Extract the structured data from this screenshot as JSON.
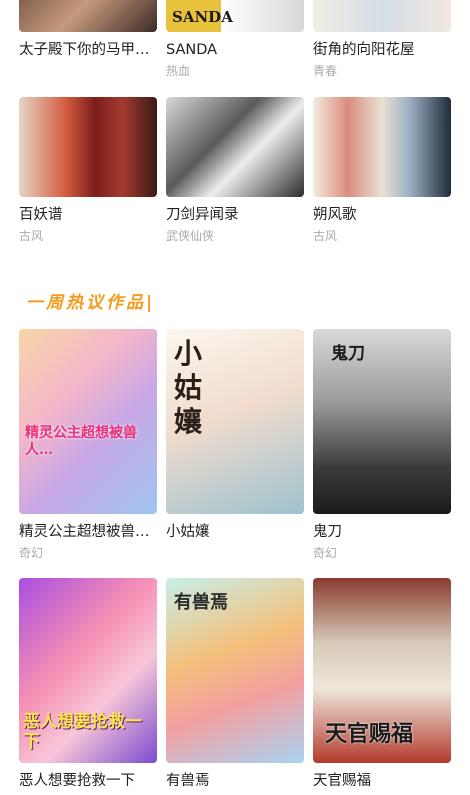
{
  "row1": [
    {
      "title": "太子殿下你的马甲…",
      "tag": ""
    },
    {
      "title": "SANDA",
      "tag": "热血",
      "cover_text": "SANDA"
    },
    {
      "title": "街角的向阳花屋",
      "tag": "青春"
    }
  ],
  "row2": [
    {
      "title": "百妖谱",
      "tag": "古风"
    },
    {
      "title": "刀剑异闻录",
      "tag": "武侠仙侠"
    },
    {
      "title": "朔风歌",
      "tag": "古风"
    }
  ],
  "section": {
    "title": "一周热议作品|"
  },
  "row3": [
    {
      "title": "精灵公主超想被兽…",
      "tag": "奇幻",
      "cover_text": "精灵公主超想被兽人…"
    },
    {
      "title": "小姑孃",
      "tag": "",
      "cover_text": "小姑孃"
    },
    {
      "title": "鬼刀",
      "tag": "奇幻",
      "cover_text": "鬼刀"
    }
  ],
  "row4": [
    {
      "title": "恶人想要抢救一下",
      "tag": "",
      "cover_text": "恶人想要抢救一下"
    },
    {
      "title": "有兽焉",
      "tag": "",
      "cover_text": "有兽焉"
    },
    {
      "title": "天官赐福",
      "tag": "",
      "cover_text": "天官赐福"
    }
  ],
  "colors": {
    "accent": "#f59a1c"
  }
}
